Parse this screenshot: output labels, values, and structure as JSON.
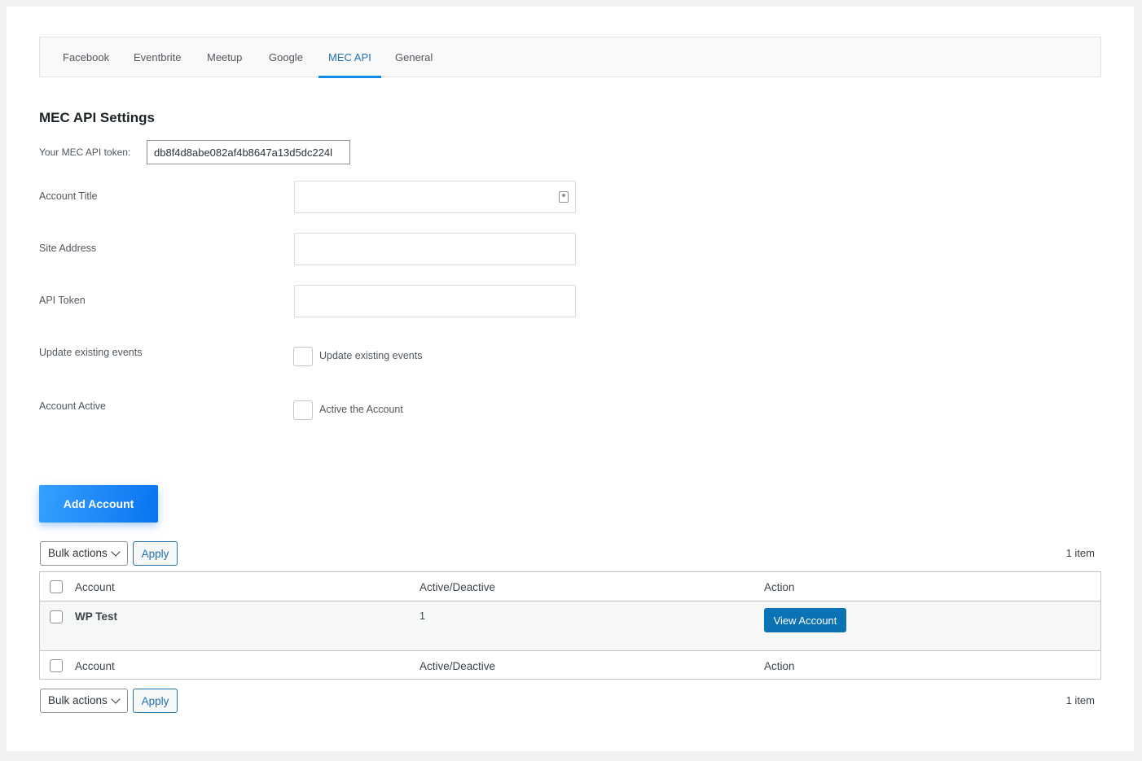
{
  "tabs": [
    {
      "label": "Facebook",
      "active": false
    },
    {
      "label": "Eventbrite",
      "active": false
    },
    {
      "label": "Meetup",
      "active": false
    },
    {
      "label": "Google",
      "active": false
    },
    {
      "label": "MEC API",
      "active": true
    },
    {
      "label": "General",
      "active": false
    }
  ],
  "settings": {
    "title": "MEC API Settings",
    "token_label": "Your MEC API token:",
    "token_value": "db8f4d8abe082af4b8647a13d5dc224l",
    "account_title_label": "Account Title",
    "site_address_label": "Site Address",
    "api_token_label": "API Token",
    "update_events_label": "Update existing events",
    "update_events_checkbox": "Update existing events",
    "account_active_label": "Account Active",
    "account_active_checkbox": "Active the Account",
    "add_account": "Add Account"
  },
  "list": {
    "bulk_actions": "Bulk actions",
    "apply": "Apply",
    "count": "1 item",
    "columns": [
      "Account",
      "Active/Deactive",
      "Action"
    ],
    "rows": [
      {
        "account": "WP Test",
        "active": "1",
        "action": "View Account"
      }
    ]
  },
  "colors": {
    "accent": "#2271b1",
    "button_gradient_start": "#35a0ff",
    "button_gradient_end": "#0a74f0",
    "view_button": "#0a73b6"
  }
}
